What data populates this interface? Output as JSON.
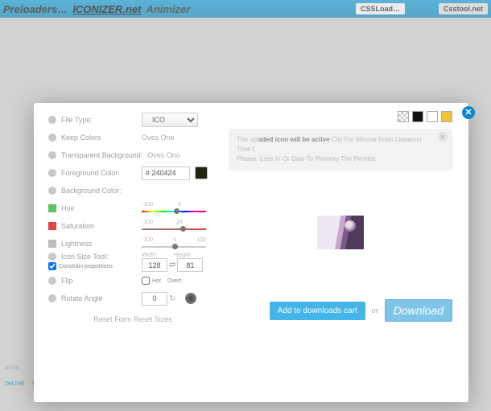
{
  "topbar": {
    "preloaders": "Preloaders…",
    "brand": "ICONIZER.net",
    "animizer": "Animizer",
    "cssload": "CSSLoad…",
    "csstool": "Csstool.net"
  },
  "logo": {
    "name": "ICONIZER",
    "suffix": ".net"
  },
  "footer": {
    "about": "ut us",
    "link1": "zer.net",
    "link2": "CSST"
  },
  "left": {
    "file_type": {
      "label": "File Type:",
      "value": "ICO"
    },
    "keep_colors": {
      "label": "Keep Colors",
      "value": "Oves One"
    },
    "transparent_bg": {
      "label": "Transparent Background:",
      "value": "Oves Ono"
    },
    "fg_color": {
      "label": "Foreground Color:",
      "value": "# 240424"
    },
    "bg_color": {
      "label": "Background Color:"
    },
    "hue": {
      "label": "Hue",
      "min": "-100",
      "mid": "2",
      "max": ""
    },
    "saturation": {
      "label": "Saturation",
      "min": "-100",
      "mid": "28",
      "max": ""
    },
    "lightness": {
      "label": "Lightness",
      "min": "-100",
      "mid": "0",
      "max": "100"
    },
    "size": {
      "label": "Icon Size Tool:",
      "width_label": "Width:",
      "height_label": "Height",
      "width": "128",
      "height": "81",
      "constrain": "Constrain proportions"
    },
    "flip": {
      "label": "Flip",
      "hor": "Hor.",
      "vert": "Overt."
    },
    "rotate": {
      "label": "Rotate Angle",
      "value": "0"
    },
    "reset": "Reset Form Reset Sizes"
  },
  "message": {
    "pre": "The upl",
    "bold": "aded icon will be active",
    "rest": " City For Minime Frem Lideanno Time t.",
    "please": "Please,",
    "link": "Loss In Or Dian To Phonory The Permist"
  },
  "actions": {
    "cart": "Add to downloads cart",
    "or": "or",
    "download": "Download"
  }
}
